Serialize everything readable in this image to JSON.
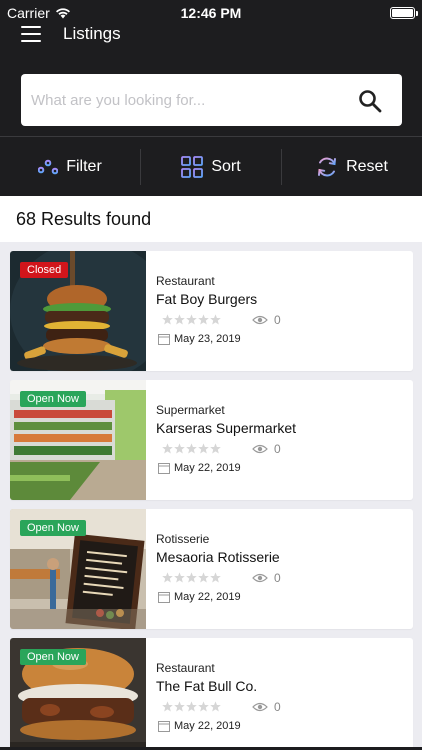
{
  "status_bar": {
    "carrier": "Carrier",
    "time": "12:46 PM"
  },
  "navbar": {
    "title": "Listings"
  },
  "search": {
    "placeholder": "What are you looking for..."
  },
  "actions": {
    "filter": "Filter",
    "sort": "Sort",
    "reset": "Reset"
  },
  "results": {
    "text": "68 Results found"
  },
  "listings": [
    {
      "status": "Closed",
      "status_color": "#d1151b",
      "category": "Restaurant",
      "name": "Fat Boy Burgers",
      "rating": 0,
      "views": "0",
      "date": "May 23, 2019",
      "image": "burger-photo"
    },
    {
      "status": "Open Now",
      "status_color": "#2aa55a",
      "category": "Supermarket",
      "name": "Karseras Supermarket",
      "rating": 0,
      "views": "0",
      "date": "May 22, 2019",
      "image": "supermarket-photo"
    },
    {
      "status": "Open Now",
      "status_color": "#2aa55a",
      "category": "Rotisserie",
      "name": "Mesaoria Rotisserie",
      "rating": 0,
      "views": "0",
      "date": "May 22, 2019",
      "image": "rotisserie-photo"
    },
    {
      "status": "Open Now",
      "status_color": "#2aa55a",
      "category": "Restaurant",
      "name": "The Fat Bull Co.",
      "rating": 0,
      "views": "0",
      "date": "May 22, 2019",
      "image": "burger-photo-2"
    }
  ],
  "icons": {
    "menu": "hamburger-menu-icon",
    "search": "magnifier-icon",
    "filter": "sliders-icon",
    "sort": "grid-sort-icon",
    "reset": "refresh-icon",
    "views": "eye-icon",
    "date": "calendar-icon",
    "rating": "star-icon"
  },
  "colors": {
    "header_bg": "#1d1d1f",
    "closed": "#d1151b",
    "open": "#2aa55a",
    "accent": "#8a7cf0"
  }
}
